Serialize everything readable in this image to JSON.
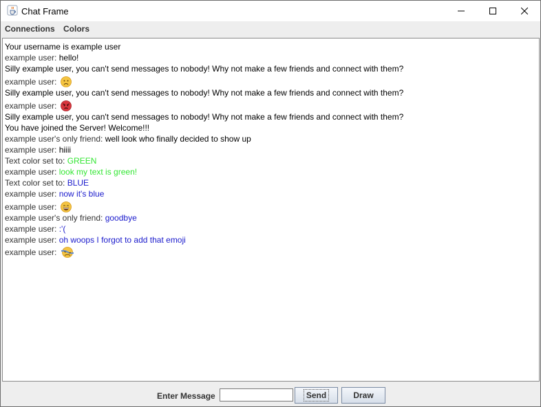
{
  "window": {
    "title": "Chat Frame",
    "icon": "java-cup-icon"
  },
  "menu": {
    "items": [
      {
        "label": "Connections"
      },
      {
        "label": "Colors"
      }
    ]
  },
  "chat": {
    "lines": [
      {
        "prefix": "",
        "text": "Your username is example user",
        "color": "#000000"
      },
      {
        "prefix": "example user: ",
        "text": "hello!",
        "color": "#000000"
      },
      {
        "prefix": "",
        "text": "Silly example user, you can't send messages to nobody! Why not make a few friends and connect with them?",
        "color": "#000000"
      },
      {
        "prefix": "example user: ",
        "text": "",
        "emoji": "frowning-face-emoji"
      },
      {
        "prefix": "",
        "text": "Silly example user, you can't send messages to nobody! Why not make a few friends and connect with them?",
        "color": "#000000"
      },
      {
        "prefix": "example user: ",
        "text": "",
        "emoji": "angry-face-emoji"
      },
      {
        "prefix": "",
        "text": "Silly example user, you can't send messages to nobody! Why not make a few friends and connect with them?",
        "color": "#000000"
      },
      {
        "prefix": "",
        "text": "You have joined the Server! Welcome!!!",
        "color": "#000000"
      },
      {
        "prefix": "example user's only friend: ",
        "text": "well look who finally decided to show up",
        "color": "#000000"
      },
      {
        "prefix": "example user: ",
        "text": "hiiii",
        "color": "#000000"
      },
      {
        "prefix": "Text color set to: ",
        "text": "GREEN",
        "color": "#33e633"
      },
      {
        "prefix": "example user: ",
        "text": "look my text is green!",
        "color": "#33e633"
      },
      {
        "prefix": "Text color set to: ",
        "text": "BLUE",
        "color": "#1a1acc"
      },
      {
        "prefix": "example user: ",
        "text": "now it's blue",
        "color": "#1a1acc"
      },
      {
        "prefix": "example user: ",
        "text": "",
        "emoji": "grinning-face-emoji"
      },
      {
        "prefix": "example user's only friend: ",
        "text": "goodbye",
        "color": "#1a1acc"
      },
      {
        "prefix": "example user: ",
        "text": ":'(",
        "color": "#1a1acc"
      },
      {
        "prefix": "example user: ",
        "text": "oh woops I forgot to add that emoji",
        "color": "#1a1acc"
      },
      {
        "prefix": "example user: ",
        "text": "",
        "emoji": "crying-face-emoji"
      }
    ]
  },
  "footer": {
    "enter_label": "Enter Message",
    "message_value": "",
    "send_label": "Send",
    "draw_label": "Draw"
  },
  "colors": {
    "green_text": "#33e633",
    "blue_text": "#1a1acc"
  }
}
